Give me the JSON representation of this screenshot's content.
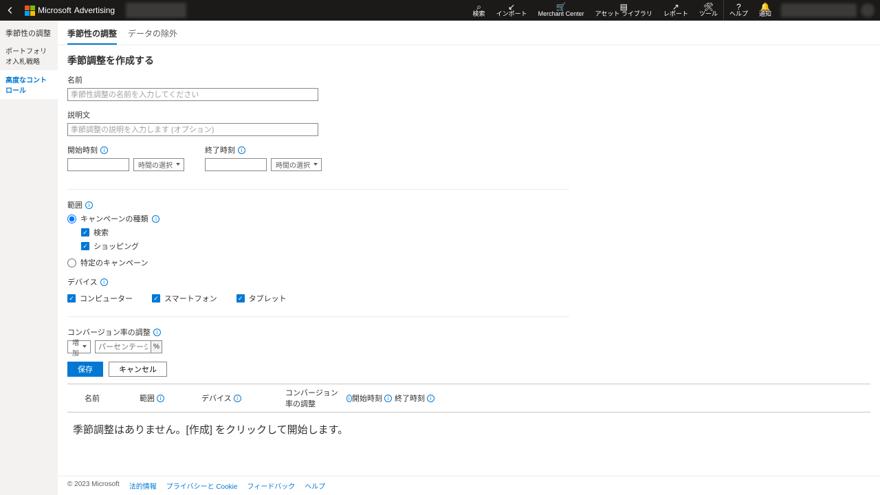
{
  "brand": {
    "ms": "Microsoft",
    "adv": "Advertising"
  },
  "top": {
    "search": "検索",
    "import": "インポート",
    "merchant": "Merchant Center",
    "assets": "アセット ライブラリ",
    "reports": "レポート",
    "tools": "ツール",
    "help": "ヘルプ",
    "notify": "通知"
  },
  "sidebar": {
    "title": "季節性の調整",
    "items": [
      "ポートフォリオ入札戦略",
      "高度なコントロール"
    ]
  },
  "tabs": [
    "季節性の調整",
    "データの除外"
  ],
  "form": {
    "heading": "季節調整を作成する",
    "name_label": "名前",
    "name_ph": "季節性調整の名前を入力してください",
    "desc_label": "説明文",
    "desc_ph": "季節調整の説明を入力します (オプション)",
    "start_label": "開始時刻",
    "end_label": "終了時刻",
    "time_ph": "時間の選択",
    "scope_label": "範囲",
    "scope_opt1": "キャンペーンの種類",
    "scope_sub1": "検索",
    "scope_sub2": "ショッピング",
    "scope_opt2": "特定のキャンペーン",
    "device_label": "デバイス",
    "device1": "コンピューター",
    "device2": "スマートフォン",
    "device3": "タブレット",
    "conv_label": "コンバージョン率の調整",
    "conv_dir": "増加",
    "conv_ph": "パーセンテージの入力",
    "pct": "%",
    "save": "保存",
    "cancel": "キャンセル"
  },
  "table": {
    "cols": [
      "名前",
      "範囲",
      "デバイス",
      "コンバージョン率の調整",
      "開始時刻",
      "終了時刻"
    ],
    "empty": "季節調整はありません。[作成] をクリックして開始します。"
  },
  "footer": {
    "copyright": "© 2023 Microsoft",
    "legal": "法的情報",
    "privacy": "プライバシーと Cookie",
    "feedback": "フィードバック",
    "help": "ヘルプ"
  }
}
